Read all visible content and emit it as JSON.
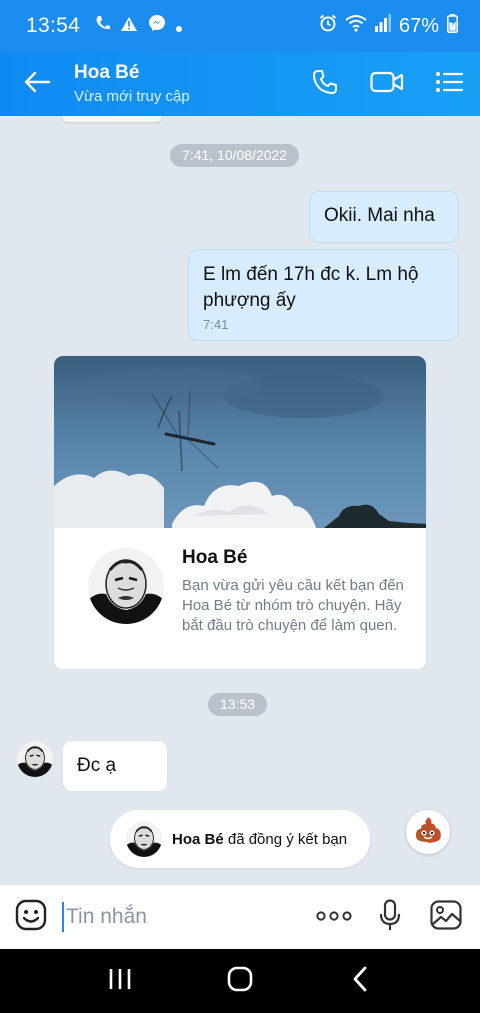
{
  "status_bar": {
    "time": "13:54",
    "battery": "67%"
  },
  "header": {
    "title": "Hoa Bé",
    "subtitle": "Vừa mới truy cập"
  },
  "chat": {
    "date_separator_1": "7:41, 10/08/2022",
    "messages_out": [
      {
        "text": "Okii. Mai nha"
      },
      {
        "text": "E lm đến 17h đc k. Lm hộ phượng ấy",
        "time": "7:41"
      }
    ],
    "friend_card": {
      "name": "Hoa Bé",
      "description": "Bạn vừa gửi yêu cầu kết bạn đến Hoa Bé từ nhóm trò chuyện. Hãy bắt đầu trò chuyện để làm quen."
    },
    "date_separator_2": "13:53",
    "message_in": {
      "text": "Đc ạ"
    },
    "system_notice": {
      "name": "Hoa Bé",
      "text": " đã đồng ý kết bạn"
    }
  },
  "input": {
    "placeholder": "Tin nhắn"
  },
  "colors": {
    "accent": "#1b8cf0",
    "bubble_out": "#d7ecfd",
    "chat_bg": "#e1e7ee"
  },
  "icons": {
    "status": [
      "wifi-calling-icon",
      "warning-icon",
      "messenger-icon",
      "dot-icon",
      "alarm-icon",
      "wifi-icon",
      "signal-icon",
      "battery-icon"
    ],
    "header": [
      "back-arrow-icon",
      "phone-icon",
      "video-call-icon",
      "menu-list-icon"
    ],
    "input": [
      "emoji-icon",
      "more-icon",
      "microphone-icon",
      "image-icon"
    ],
    "nav": [
      "recents-icon",
      "home-icon",
      "back-icon"
    ]
  }
}
